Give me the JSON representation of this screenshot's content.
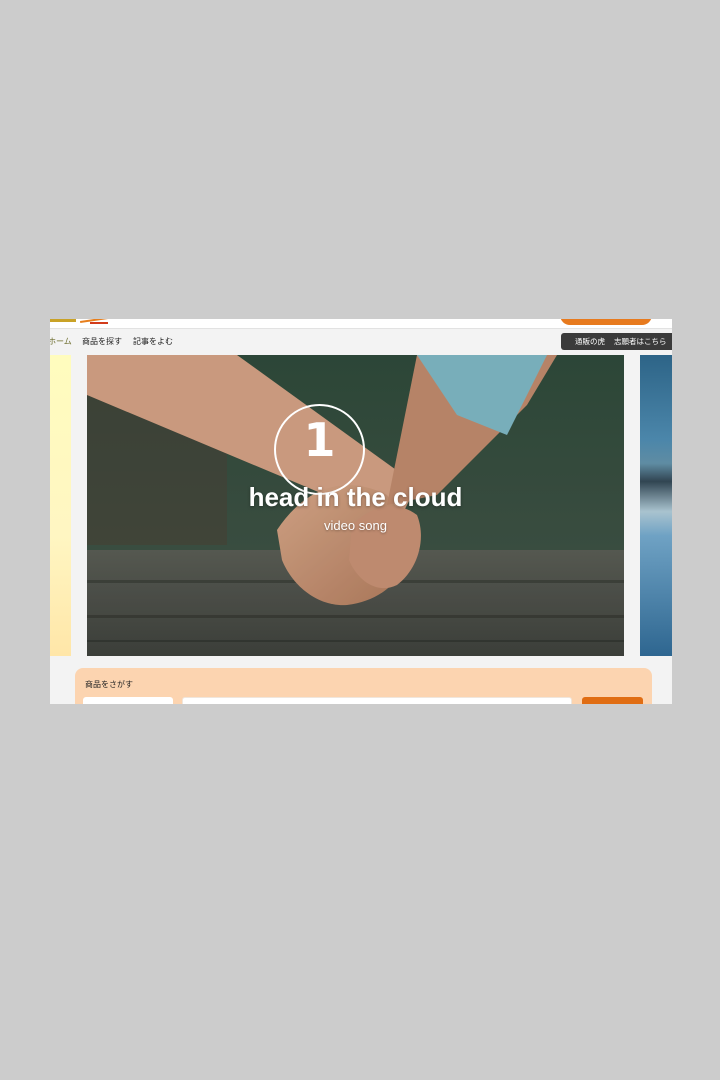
{
  "nav": {
    "home": "ホーム",
    "search_products": "商品を探す",
    "read_articles": "記事をよむ",
    "right_link_1": "通販の虎",
    "right_link_2": "志願者はこちら"
  },
  "carousel": {
    "slide": {
      "number": "1",
      "title": "head in the cloud",
      "subtitle": "video song"
    }
  },
  "search": {
    "label": "商品をさがす"
  },
  "colors": {
    "page_background": "#cccccc",
    "accent_orange": "#e06d13",
    "search_panel": "#fcd4b0",
    "nav_dark": "#3b3b3b"
  }
}
